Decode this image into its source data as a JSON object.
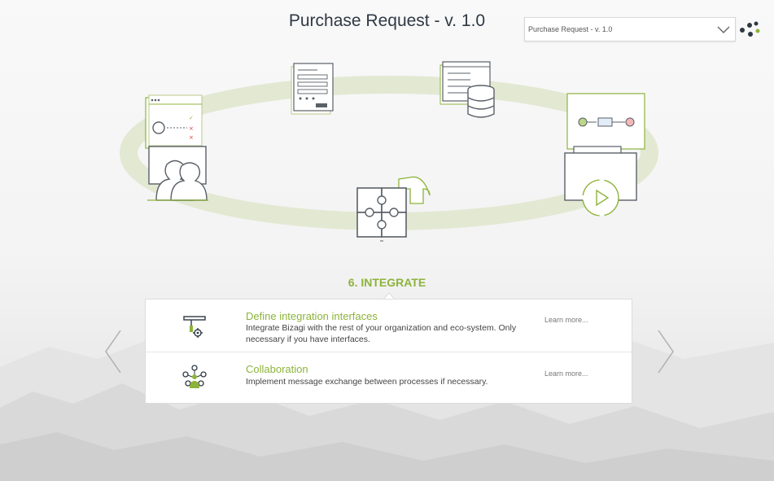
{
  "page": {
    "title": "Purchase Request - v. 1.0"
  },
  "version_select": {
    "selected": "Purchase Request - v. 1.0"
  },
  "step": {
    "title": "6. INTEGRATE"
  },
  "tasks": [
    {
      "icon": "integration-icon",
      "title": "Define integration interfaces",
      "description": "Integrate Bizagi with the rest of your organization and eco-system. Only necessary if you have interfaces.",
      "link": "Learn more..."
    },
    {
      "icon": "collaboration-icon",
      "title": "Collaboration",
      "description": "Implement message exchange between processes if necessary.",
      "link": "Learn more..."
    }
  ],
  "colors": {
    "accent": "#8db33b",
    "title": "#2f3944",
    "line": "#5a6068",
    "ring": "#e3e8d3"
  }
}
